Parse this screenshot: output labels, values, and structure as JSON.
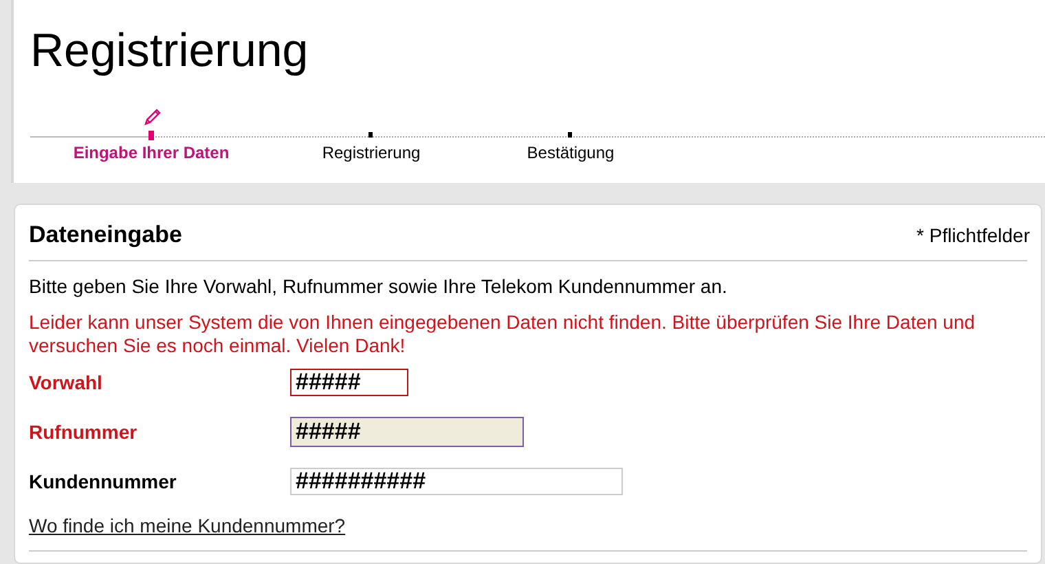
{
  "title": "Registrierung",
  "steps": [
    {
      "label": "Eingabe Ihrer Daten",
      "selected": true
    },
    {
      "label": "Registrierung",
      "selected": false
    },
    {
      "label": "Bestätigung",
      "selected": false
    }
  ],
  "form": {
    "heading": "Dateneingabe",
    "required_note": "* Pflichtfelder",
    "intro": "Bitte geben Sie Ihre Vorwahl, Rufnummer sowie Ihre Telekom Kundennummer an.",
    "error_message": "Leider kann unser System die von Ihnen eingegebenen Daten nicht finden. Bitte überprüfen Sie Ihre Daten und versuchen Sie es noch einmal. Vielen Dank!",
    "fields": [
      {
        "label": "Vorwahl",
        "value": "#####",
        "error": true,
        "focused": false
      },
      {
        "label": "Rufnummer",
        "value": "#####",
        "error": true,
        "focused": true
      },
      {
        "label": "Kundennummer",
        "value": "##########",
        "error": false,
        "focused": false
      }
    ],
    "help_link": "Wo finde ich meine Kundennummer?"
  }
}
